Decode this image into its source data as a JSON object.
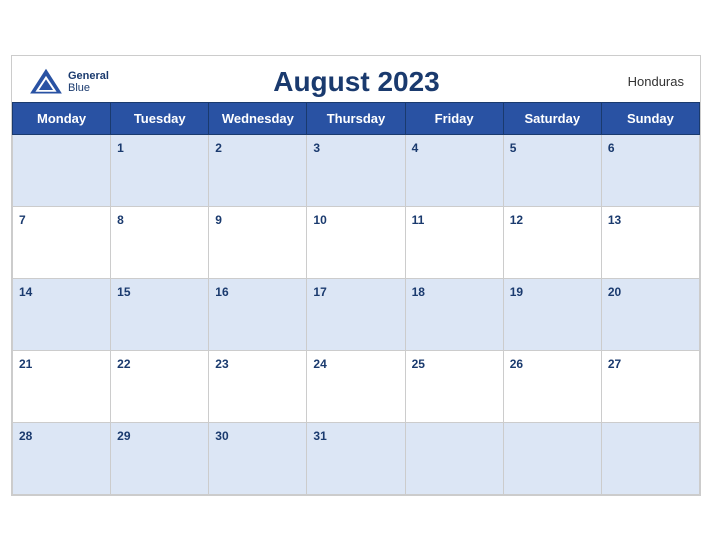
{
  "header": {
    "title": "August 2023",
    "country": "Honduras",
    "logo_general": "General",
    "logo_blue": "Blue"
  },
  "weekdays": [
    "Monday",
    "Tuesday",
    "Wednesday",
    "Thursday",
    "Friday",
    "Saturday",
    "Sunday"
  ],
  "weeks": [
    [
      null,
      1,
      2,
      3,
      4,
      5,
      6
    ],
    [
      7,
      8,
      9,
      10,
      11,
      12,
      13
    ],
    [
      14,
      15,
      16,
      17,
      18,
      19,
      20
    ],
    [
      21,
      22,
      23,
      24,
      25,
      26,
      27
    ],
    [
      28,
      29,
      30,
      31,
      null,
      null,
      null
    ]
  ]
}
